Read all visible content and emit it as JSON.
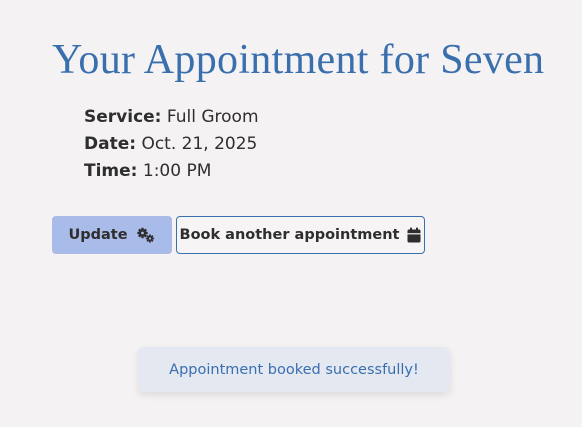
{
  "page": {
    "title": "Your Appointment for Seven"
  },
  "appointment": {
    "service_label": "Service:",
    "service_value": "Full Groom",
    "date_label": "Date:",
    "date_value": "Oct. 21, 2025",
    "time_label": "Time:",
    "time_value": "1:00 PM"
  },
  "actions": {
    "update_label": "Update",
    "update_icon": "gears-icon",
    "book_label": "Book another appointment",
    "book_icon": "calendar-icon"
  },
  "toast": {
    "message": "Appointment booked successfully!"
  },
  "colors": {
    "background": "#f5f2f3",
    "title": "#3a6fae",
    "update_button": "#a9bbe8",
    "book_button_border": "#3a6fae",
    "toast_background": "#e3e8f1",
    "toast_text": "#3a6fae"
  }
}
